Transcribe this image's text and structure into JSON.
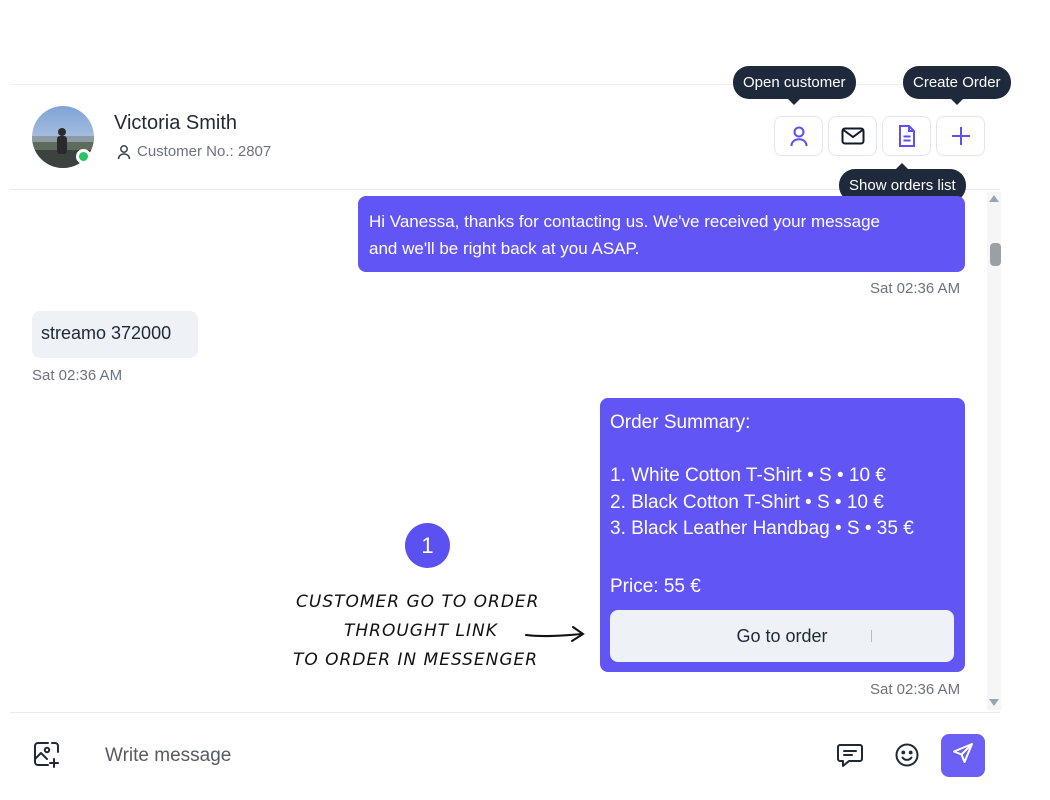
{
  "header": {
    "contact_name": "Victoria Smith",
    "customer_no": "Customer No.: 2807",
    "status": "online",
    "actions": {
      "open_customer_icon": "user-icon",
      "email_icon": "mail-icon",
      "orders_list_icon": "document-icon",
      "create_order_icon": "plus-icon"
    }
  },
  "tooltips": {
    "open_customer": "Open customer",
    "create_order": "Create Order",
    "show_orders_list": "Show orders list"
  },
  "messages": [
    {
      "direction": "outgoing",
      "lines": [
        "Hi Vanessa, thanks for contacting us. We've received your message",
        "and we'll be right back at you ASAP."
      ],
      "time": "Sat 02:36 AM"
    },
    {
      "direction": "incoming",
      "text": "streamo 372000",
      "time": "Sat 02:36 AM"
    },
    {
      "direction": "outgoing",
      "lines": [
        "Order Summary:",
        "",
        "1. White Cotton T-Shirt • S • 10 €",
        "2. Black Cotton T-Shirt • S • 10 €",
        "3. Black Leather Handbag • S • 35 €"
      ],
      "price": "Price: 55 €",
      "button": "Go to order",
      "time": "Sat 02:36 AM"
    }
  ],
  "annotation": {
    "step": "1",
    "lines": [
      "CUSTOMER GO TO ORDER",
      "THROUGHT LINK",
      "TO ORDER IN MESSENGER"
    ]
  },
  "composer": {
    "placeholder": "Write message",
    "attach_icon": "image-add-icon",
    "quick_reply_icon": "chat-icon",
    "emoji_icon": "smile-icon",
    "send_icon": "send-icon"
  },
  "colors": {
    "accent": "#6255f6",
    "tooltip_bg": "#1e293b",
    "incoming_bg": "#eef1f6",
    "online": "#22c55e"
  }
}
